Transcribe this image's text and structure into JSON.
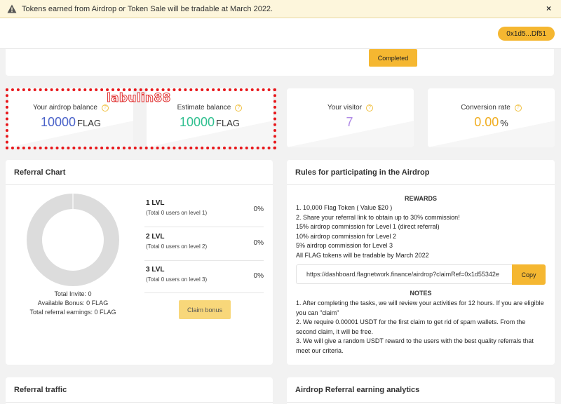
{
  "banner": {
    "text": "Tokens earned from Airdrop or Token Sale will be tradable at March 2022.",
    "close": "×",
    "icon": "warning-icon"
  },
  "header": {
    "wallet": "0x1d5...Df51"
  },
  "status": {
    "completed_label": "Completed"
  },
  "stats": [
    {
      "label": "Your airdrop balance",
      "value": "10000",
      "unit": "FLAG",
      "color": "#4a62c9"
    },
    {
      "label": "Estimate balance",
      "value": "10000",
      "unit": "FLAG",
      "color": "#2fbf8f"
    },
    {
      "label": "Your visitor",
      "value": "7",
      "unit": "",
      "color": "#b08ae6"
    },
    {
      "label": "Conversion rate",
      "value": "0.00",
      "unit": "%",
      "color": "#f0ad20"
    }
  ],
  "help_glyph": "?",
  "watermark": "labulin88",
  "referral": {
    "title": "Referral Chart",
    "total_invite": "Total Invite: 0",
    "available_bonus": "Available Bonus: 0 FLAG",
    "total_earnings": "Total referral earnings: 0 FLAG",
    "levels": [
      {
        "title": "1 LVL",
        "sub": "(Total 0 users on level 1)",
        "pct": "0%"
      },
      {
        "title": "2 LVL",
        "sub": "(Total 0 users on level 2)",
        "pct": "0%"
      },
      {
        "title": "3 LVL",
        "sub": "(Total 0 users on level 3)",
        "pct": "0%"
      }
    ],
    "claim_label": "Claim bonus"
  },
  "rules": {
    "title": "Rules for participating in the Airdrop",
    "rewards_heading": "REWARDS",
    "rewards": [
      "1. 10,000 Flag Token ( Value $20 )",
      "2. Share your referral link to obtain up to 30% commission!",
      "15% airdrop commission for Level 1 (direct referral)",
      "10% airdrop commission for Level 2",
      "5% airdrop commission for Level 3",
      "All FLAG tokens will be tradable by March 2022"
    ],
    "link": "https://dashboard.flagnetwork.finance/airdrop?claimRef=0x1d55342e",
    "copy_label": "Copy",
    "notes_heading": "NOTES",
    "notes": [
      "1. After completing the tasks, we will review your activities for 12 hours. If you are eligible you can \"claim\"",
      "2. We require 0.00001 USDT for the first claim to get rid of spam wallets. From the second claim, it will be free.",
      "3. We will give a random USDT reward to the users with the best quality referrals that meet our criteria."
    ]
  },
  "bottom": {
    "traffic_title": "Referral traffic",
    "analytics_title": "Airdrop Referral earning analytics"
  }
}
